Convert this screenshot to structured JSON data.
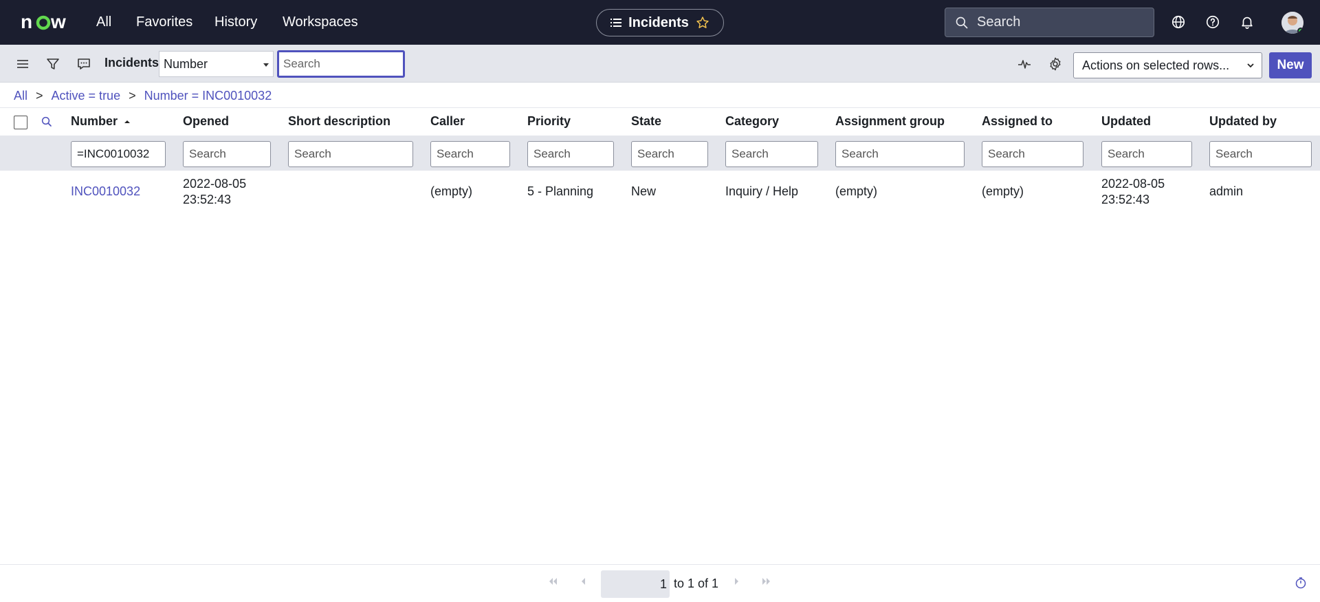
{
  "header": {
    "logo": "now",
    "nav": [
      "All",
      "Favorites",
      "History",
      "Workspaces"
    ],
    "context_pill": "Incidents",
    "search_placeholder": "Search"
  },
  "toolbar": {
    "title": "Incidents",
    "field_select": "Number",
    "search_placeholder": "Search",
    "actions_select": "Actions on selected rows...",
    "new_label": "New"
  },
  "breadcrumb": [
    "All",
    "Active = true",
    "Number = INC0010032"
  ],
  "table": {
    "columns": [
      "Number",
      "Opened",
      "Short description",
      "Caller",
      "Priority",
      "State",
      "Category",
      "Assignment group",
      "Assigned to",
      "Updated",
      "Updated by"
    ],
    "sort_column": "Number",
    "filter_values": {
      "number": "=INC0010032",
      "placeholder": "Search"
    },
    "rows": [
      {
        "number": "INC0010032",
        "opened_date": "2022-08-05",
        "opened_time": "23:52:43",
        "short_description": "",
        "caller": "(empty)",
        "priority": "5 - Planning",
        "state": "New",
        "category": "Inquiry / Help",
        "assignment_group": "(empty)",
        "assigned_to": "(empty)",
        "updated_date": "2022-08-05",
        "updated_time": "23:52:43",
        "updated_by": "admin"
      }
    ]
  },
  "pagination": {
    "current": "1",
    "summary": "to 1 of 1"
  },
  "colors": {
    "header_bg": "#1b1e2f",
    "accent": "#4f52bd",
    "toolbar_bg": "#e4e6ec"
  }
}
